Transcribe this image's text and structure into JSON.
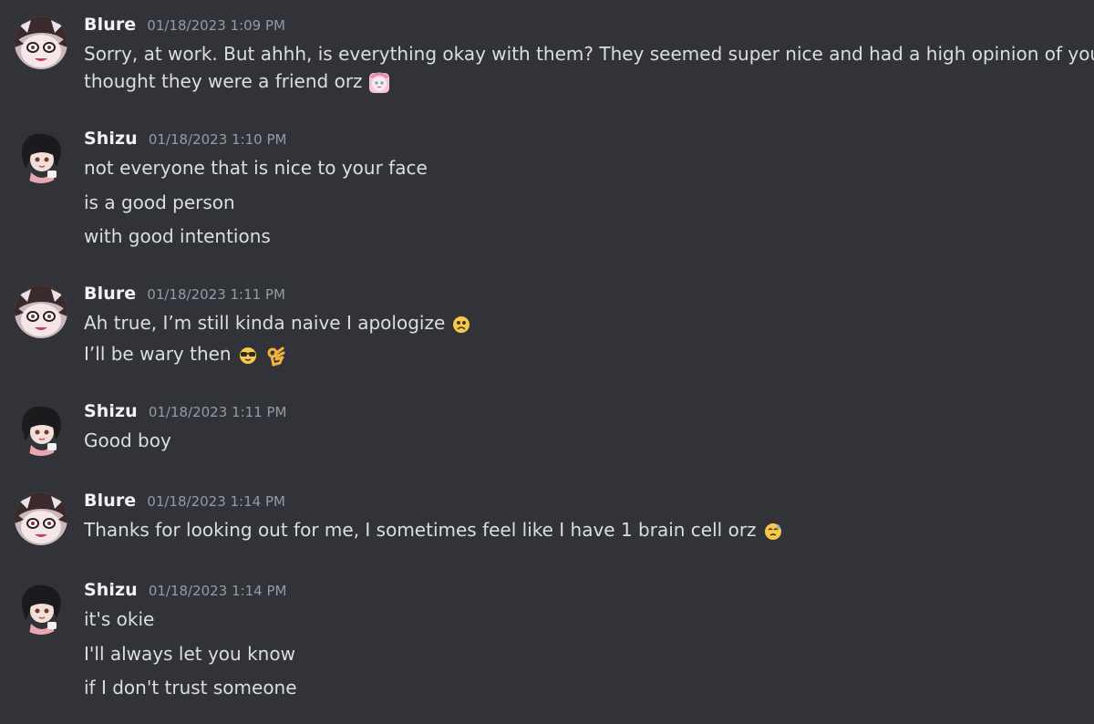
{
  "messages": [
    {
      "author": "Blure",
      "timestamp": "01/18/2023 1:09 PM",
      "avatar": "blure-avatar",
      "lines": [
        "Sorry, at work. But ahhh, is everything okay with them? They seemed super nice and had a high opinion of you so I",
        "thought they were a friend orz"
      ]
    },
    {
      "author": "Shizu",
      "timestamp": "01/18/2023 1:10 PM",
      "avatar": "shizu-avatar",
      "lines": [
        "not everyone that is nice to your face",
        "is a good person",
        "with good intentions"
      ]
    },
    {
      "author": "Blure",
      "timestamp": "01/18/2023 1:11 PM",
      "avatar": "blure-avatar",
      "lines": [
        "Ah true, I’m still kinda naive I apologize",
        "I’ll be wary then"
      ]
    },
    {
      "author": "Shizu",
      "timestamp": "01/18/2023 1:11 PM",
      "avatar": "shizu-avatar",
      "lines": [
        "Good boy"
      ]
    },
    {
      "author": "Blure",
      "timestamp": "01/18/2023 1:14 PM",
      "avatar": "blure-avatar",
      "lines": [
        "Thanks for looking out for me, I sometimes feel like I have 1 brain cell orz"
      ]
    },
    {
      "author": "Shizu",
      "timestamp": "01/18/2023 1:14 PM",
      "avatar": "shizu-avatar",
      "lines": [
        "it's okie",
        "I'll always let you know",
        "if I don't trust someone"
      ]
    }
  ],
  "colors": {
    "background": "#313338",
    "username": "#f2f3f5",
    "timestamp": "#949ba4",
    "text": "#dbdee1"
  }
}
